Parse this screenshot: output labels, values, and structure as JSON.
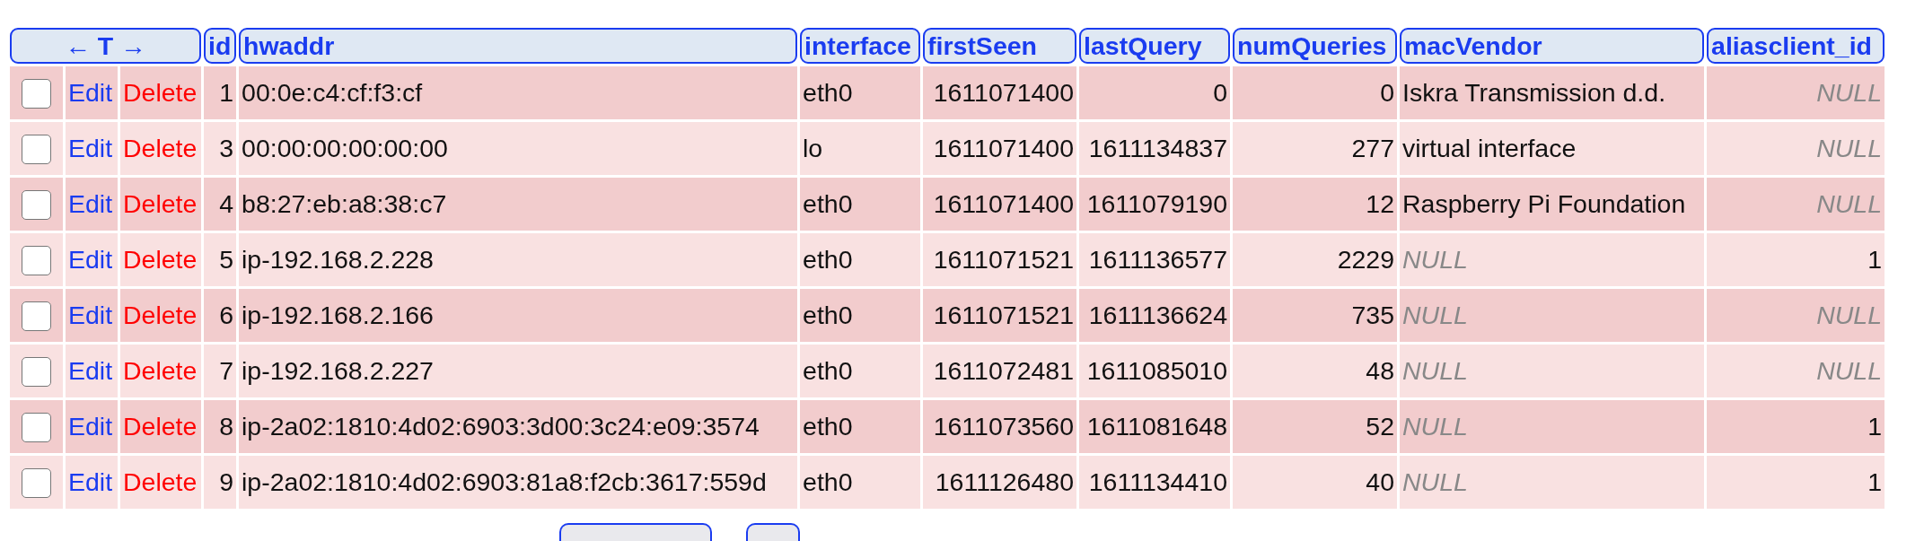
{
  "table": {
    "nav_header": "← T →",
    "columns": [
      {
        "label": "id",
        "kind": "number"
      },
      {
        "label": "hwaddr",
        "kind": "text"
      },
      {
        "label": "interface",
        "kind": "text"
      },
      {
        "label": "firstSeen",
        "kind": "number"
      },
      {
        "label": "lastQuery",
        "kind": "number"
      },
      {
        "label": "numQueries",
        "kind": "number"
      },
      {
        "label": "macVendor",
        "kind": "text"
      },
      {
        "label": "aliasclient_id",
        "kind": "number"
      }
    ],
    "rows": [
      {
        "checked": false,
        "edit": "Edit",
        "delete": "Delete",
        "cells": [
          {
            "text": "1",
            "null": false
          },
          {
            "text": "00:0e:c4:cf:f3:cf",
            "null": false
          },
          {
            "text": "eth0",
            "null": false
          },
          {
            "text": "1611071400",
            "null": false
          },
          {
            "text": "0",
            "null": false
          },
          {
            "text": "0",
            "null": false
          },
          {
            "text": "Iskra Transmission d.d.",
            "null": false
          },
          {
            "text": "NULL",
            "null": true
          }
        ]
      },
      {
        "checked": false,
        "edit": "Edit",
        "delete": "Delete",
        "cells": [
          {
            "text": "3",
            "null": false
          },
          {
            "text": "00:00:00:00:00:00",
            "null": false
          },
          {
            "text": "lo",
            "null": false
          },
          {
            "text": "1611071400",
            "null": false
          },
          {
            "text": "1611134837",
            "null": false
          },
          {
            "text": "277",
            "null": false
          },
          {
            "text": "virtual interface",
            "null": false
          },
          {
            "text": "NULL",
            "null": true
          }
        ]
      },
      {
        "checked": false,
        "edit": "Edit",
        "delete": "Delete",
        "cells": [
          {
            "text": "4",
            "null": false
          },
          {
            "text": "b8:27:eb:a8:38:c7",
            "null": false
          },
          {
            "text": "eth0",
            "null": false
          },
          {
            "text": "1611071400",
            "null": false
          },
          {
            "text": "1611079190",
            "null": false
          },
          {
            "text": "12",
            "null": false
          },
          {
            "text": "Raspberry Pi Foundation",
            "null": false
          },
          {
            "text": "NULL",
            "null": true
          }
        ]
      },
      {
        "checked": false,
        "edit": "Edit",
        "delete": "Delete",
        "cells": [
          {
            "text": "5",
            "null": false
          },
          {
            "text": "ip-192.168.2.228",
            "null": false
          },
          {
            "text": "eth0",
            "null": false
          },
          {
            "text": "1611071521",
            "null": false
          },
          {
            "text": "1611136577",
            "null": false
          },
          {
            "text": "2229",
            "null": false
          },
          {
            "text": "NULL",
            "null": true
          },
          {
            "text": "1",
            "null": false
          }
        ]
      },
      {
        "checked": false,
        "edit": "Edit",
        "delete": "Delete",
        "cells": [
          {
            "text": "6",
            "null": false
          },
          {
            "text": "ip-192.168.2.166",
            "null": false
          },
          {
            "text": "eth0",
            "null": false
          },
          {
            "text": "1611071521",
            "null": false
          },
          {
            "text": "1611136624",
            "null": false
          },
          {
            "text": "735",
            "null": false
          },
          {
            "text": "NULL",
            "null": true
          },
          {
            "text": "NULL",
            "null": true
          }
        ]
      },
      {
        "checked": false,
        "edit": "Edit",
        "delete": "Delete",
        "cells": [
          {
            "text": "7",
            "null": false
          },
          {
            "text": "ip-192.168.2.227",
            "null": false
          },
          {
            "text": "eth0",
            "null": false
          },
          {
            "text": "1611072481",
            "null": false
          },
          {
            "text": "1611085010",
            "null": false
          },
          {
            "text": "48",
            "null": false
          },
          {
            "text": "NULL",
            "null": true
          },
          {
            "text": "NULL",
            "null": true
          }
        ]
      },
      {
        "checked": false,
        "edit": "Edit",
        "delete": "Delete",
        "cells": [
          {
            "text": "8",
            "null": false
          },
          {
            "text": "ip-2a02:1810:4d02:6903:3d00:3c24:e09:3574",
            "null": false
          },
          {
            "text": "eth0",
            "null": false
          },
          {
            "text": "1611073560",
            "null": false
          },
          {
            "text": "1611081648",
            "null": false
          },
          {
            "text": "52",
            "null": false
          },
          {
            "text": "NULL",
            "null": true
          },
          {
            "text": "1",
            "null": false
          }
        ]
      },
      {
        "checked": false,
        "edit": "Edit",
        "delete": "Delete",
        "cells": [
          {
            "text": "9",
            "null": false
          },
          {
            "text": "ip-2a02:1810:4d02:6903:81a8:f2cb:3617:559d",
            "null": false
          },
          {
            "text": "eth0",
            "null": false
          },
          {
            "text": "1611126480",
            "null": false
          },
          {
            "text": "1611134410",
            "null": false
          },
          {
            "text": "40",
            "null": false
          },
          {
            "text": "NULL",
            "null": true
          },
          {
            "text": "1",
            "null": false
          }
        ]
      }
    ]
  }
}
